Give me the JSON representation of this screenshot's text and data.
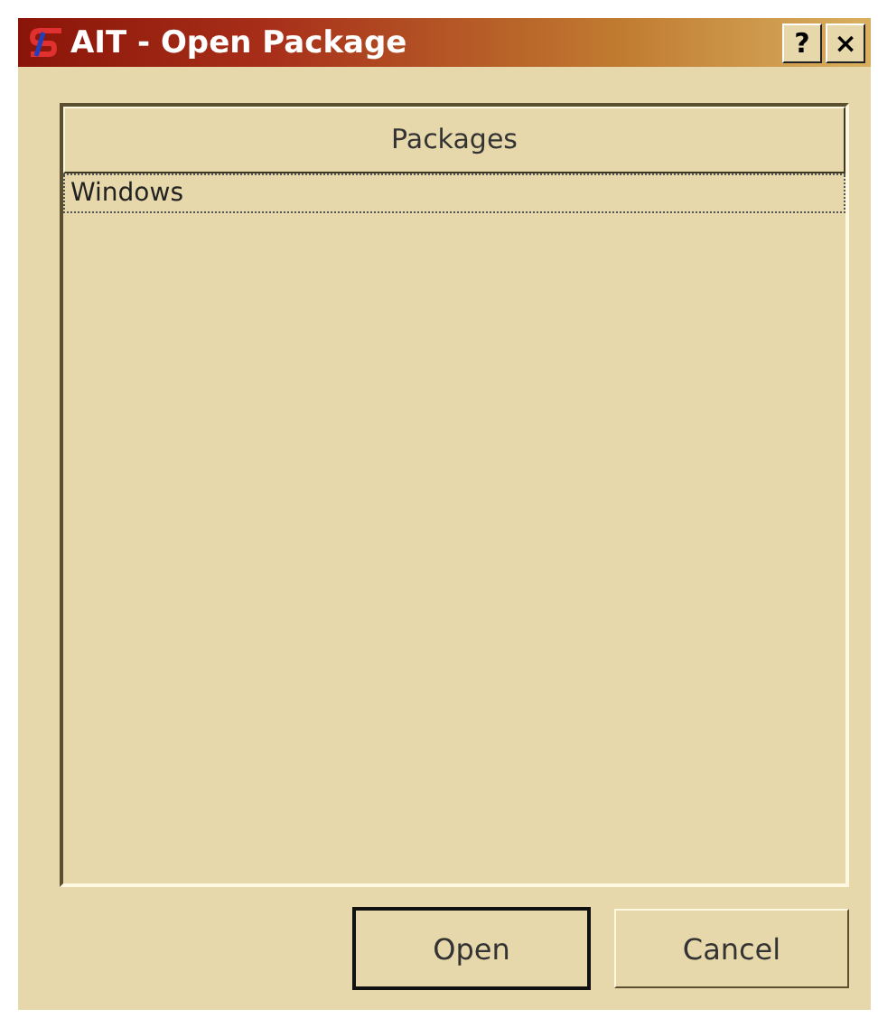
{
  "window": {
    "title": "AIT - Open Package"
  },
  "title_buttons": [
    "?",
    "×"
  ],
  "list": {
    "columns": [
      "Packages"
    ],
    "rows": [
      {
        "name": "Windows",
        "selected": true
      }
    ]
  },
  "buttons": [
    {
      "label": "Open",
      "default": true
    },
    {
      "label": "Cancel",
      "default": false
    }
  ]
}
